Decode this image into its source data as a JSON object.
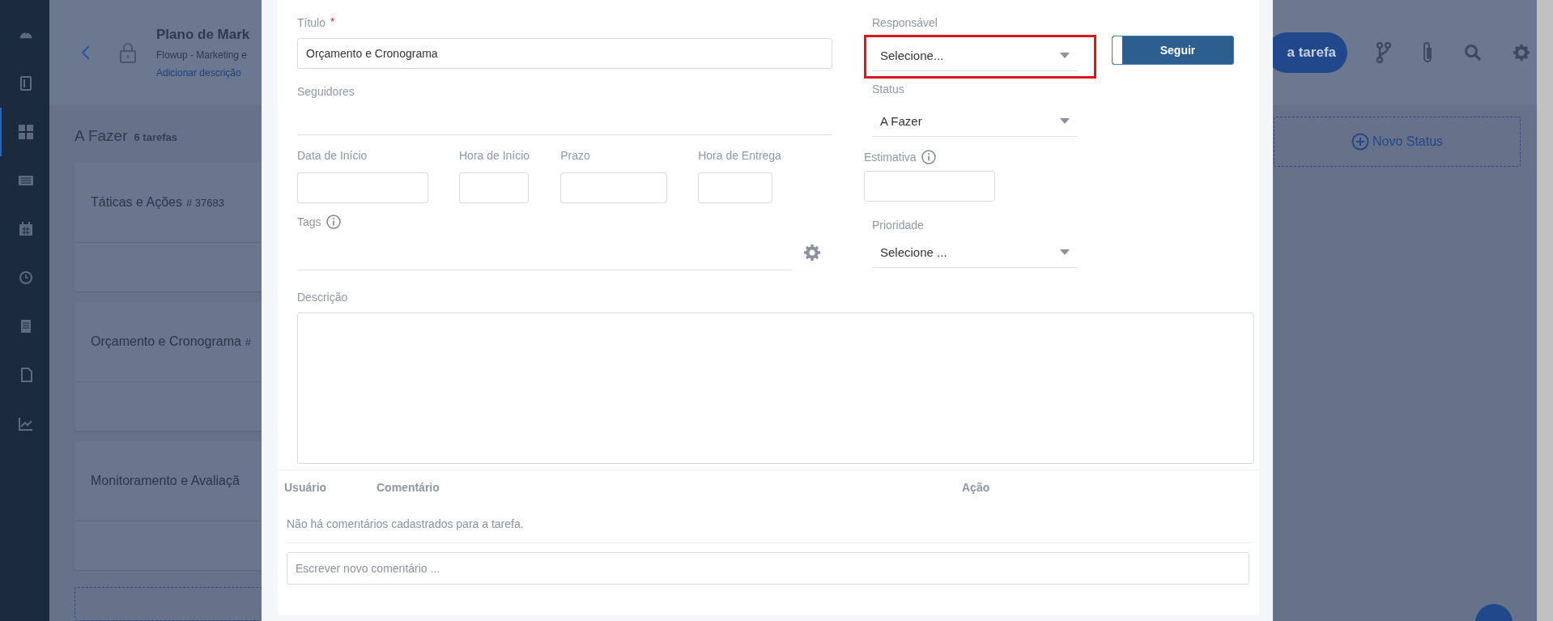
{
  "sidebar": {
    "items": [
      {
        "selected": false
      },
      {
        "selected": false
      },
      {
        "selected": true
      },
      {
        "selected": false
      },
      {
        "selected": false
      },
      {
        "selected": false
      },
      {
        "selected": false
      },
      {
        "selected": false
      },
      {
        "selected": false
      }
    ]
  },
  "project": {
    "title": "Plano de Mark",
    "subtitle": "Flowup - Marketing e",
    "add_description_link": "Adicionar descrição"
  },
  "header": {
    "new_task_button": "a tarefa"
  },
  "board": {
    "column": {
      "title": "A Fazer",
      "count": "6 tarefas",
      "cards": [
        {
          "title": "Táticas e Ações",
          "number": "# 37683"
        },
        {
          "title": "Orçamento e Cronograma",
          "number": "#"
        },
        {
          "title": "Monitoramento e Avaliaçã"
        }
      ]
    },
    "new_status_button": "Novo Status"
  },
  "modal": {
    "title_field": {
      "label": "Título",
      "required_mark": "*",
      "value": "Orçamento e Cronograma"
    },
    "followers": {
      "label": "Seguidores"
    },
    "dates": [
      {
        "label": "Data de Início"
      },
      {
        "label": "Hora de Início"
      },
      {
        "label": "Prazo"
      },
      {
        "label": "Hora de Entrega"
      }
    ],
    "tags": {
      "label": "Tags"
    },
    "responsible": {
      "label": "Responsável",
      "value": "Selecione...",
      "highlighted": true
    },
    "follow_button": "Seguir",
    "status": {
      "label": "Status",
      "value": "A Fazer"
    },
    "estimate": {
      "label": "Estimativa"
    },
    "priority": {
      "label": "Prioridade",
      "value": "Selecione ..."
    },
    "description": {
      "label": "Descrição"
    },
    "comments": {
      "columns": [
        "Usuário",
        "Comentário",
        "Ação"
      ],
      "empty_message": "Não há comentários cadastrados para a tarefa.",
      "new_comment": {
        "placeholder": "Escrever novo comentário ..."
      }
    }
  }
}
